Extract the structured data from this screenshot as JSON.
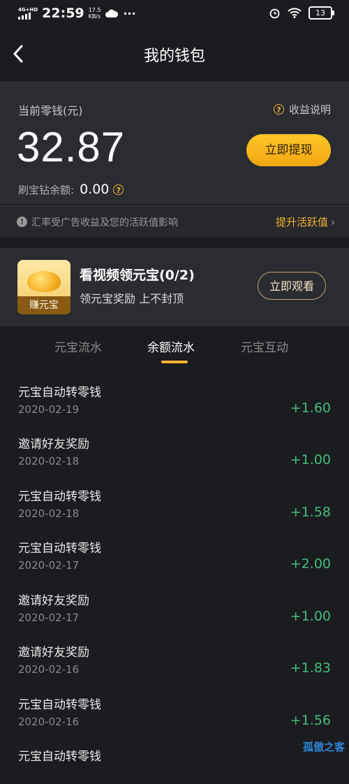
{
  "status_bar": {
    "network": "4G+HD",
    "time": "22:59",
    "speed_value": "17.5",
    "speed_unit": "KB/s",
    "more": "···",
    "battery": "13"
  },
  "nav": {
    "title": "我的钱包"
  },
  "wallet": {
    "label": "当前零钱(元)",
    "help_label": "收益说明",
    "amount": "32.87",
    "withdraw_label": "立即提现",
    "balance_label": "刷宝钻余额:",
    "balance_value": "0.00"
  },
  "notice": {
    "text": "汇率受广告收益及您的活跃值影响",
    "link": "提升活跃值"
  },
  "promo": {
    "image_tag": "赚元宝",
    "title": "看视频领元宝(0/2)",
    "subtitle": "领元宝奖励 上不封顶",
    "button": "立即观看"
  },
  "tabs": [
    {
      "label": "元宝流水",
      "active": false
    },
    {
      "label": "余额流水",
      "active": true
    },
    {
      "label": "元宝互动",
      "active": false
    }
  ],
  "transactions": [
    {
      "title": "元宝自动转零钱",
      "date": "2020-02-19",
      "amount": "+1.60"
    },
    {
      "title": "邀请好友奖励",
      "date": "2020-02-18",
      "amount": "+1.00"
    },
    {
      "title": "元宝自动转零钱",
      "date": "2020-02-18",
      "amount": "+1.58"
    },
    {
      "title": "元宝自动转零钱",
      "date": "2020-02-17",
      "amount": "+2.00"
    },
    {
      "title": "邀请好友奖励",
      "date": "2020-02-17",
      "amount": "+1.00"
    },
    {
      "title": "邀请好友奖励",
      "date": "2020-02-16",
      "amount": "+1.83"
    },
    {
      "title": "元宝自动转零钱",
      "date": "2020-02-16",
      "amount": "+1.56"
    },
    {
      "title": "元宝自动转零钱",
      "date": "",
      "amount": ""
    }
  ],
  "watermark": "孤傲之客",
  "colors": {
    "accent": "#f3b431",
    "positive": "#3fbf7a",
    "background": "#1b1c20",
    "card": "#2a2c31"
  }
}
